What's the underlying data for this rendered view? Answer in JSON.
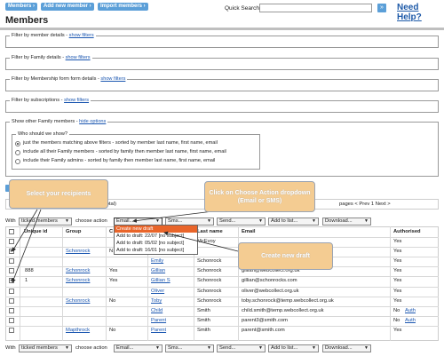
{
  "nav": {
    "members": "Members",
    "add_new_member": "Add new member",
    "import_members": "Import members"
  },
  "quick_search": {
    "label": "Quick Search",
    "value": ""
  },
  "help": "Need Help?",
  "page_title": "Members",
  "filters": {
    "member_details": {
      "label": "Filter by member details - ",
      "link": "show filters"
    },
    "family_details": {
      "label": "Filter by Family details - ",
      "link": "show filters"
    },
    "membership_form": {
      "label": "Filter by Membership form form details - ",
      "link": "show filters"
    },
    "subscriptions": {
      "label": "Filter by subscriptions - ",
      "link": "show filters"
    }
  },
  "other_family": {
    "label": "Show other Family members - ",
    "link": "hide options",
    "question": "Who should we show?",
    "options": [
      "just the members matching above filters - sorted by member last name, first name, email",
      "include all their Family members - sorted by family then member last name, first name, email",
      "include their Family admins - sorted by family then member last name, first name, email"
    ]
  },
  "pager": {
    "total_fragment": "total)",
    "nav": "pages < Prev 1 Next >"
  },
  "actions": {
    "with": "With",
    "ticked_members": "ticked members",
    "choose_action": "choose action",
    "email": "Email...",
    "sms": "Sms...",
    "send": "Send...",
    "add_to_list": "Add to list...",
    "download": "Download..."
  },
  "dropdown": [
    "Create new draft",
    "Add to draft: 22/07 [no subject]",
    "Add to draft: 05/02 [no subject]",
    "Add to draft: 16/01 [no subject]"
  ],
  "columns": [
    "Unique id",
    "Group",
    "C",
    "",
    "Last name",
    "Email",
    "Authorised"
  ],
  "rows": [
    {
      "checked": false,
      "uid": "",
      "group": "",
      "c": "",
      "first": "",
      "last": "McEvoy",
      "email": "",
      "auth": "Yes",
      "auth_link": ""
    },
    {
      "checked": true,
      "uid": "",
      "group": "Schonrock",
      "c": "N",
      "first": "",
      "last": "",
      "email": "",
      "auth": "Yes",
      "auth_link": ""
    },
    {
      "checked": false,
      "uid": "",
      "group": "",
      "c": "",
      "first": "Emily",
      "last": "Schonrock",
      "email": "@webcollect.org.uk",
      "auth": "Yes",
      "auth_link": ""
    },
    {
      "checked": false,
      "uid": "888",
      "group": "Schonrock",
      "c": "Yes",
      "first": "Gillian",
      "last": "Schonrock",
      "email": "gillian@webcollect.org.uk",
      "auth": "Yes",
      "auth_link": ""
    },
    {
      "checked": true,
      "uid": "1",
      "group": "Schonrock",
      "c": "Yes",
      "first": "Gillian S",
      "last": "Schonrock",
      "email": "gillian@schonrocks.com",
      "auth": "Yes",
      "auth_link": ""
    },
    {
      "checked": false,
      "uid": "",
      "group": "",
      "c": "",
      "first": "Oliver",
      "last": "Schonrock",
      "email": "oliver@webcollect.org.uk",
      "auth": "Yes",
      "auth_link": ""
    },
    {
      "checked": false,
      "uid": "",
      "group": "Schonrock",
      "c": "No",
      "first": "Toby",
      "last": "Schonrock",
      "email": "toby.schonrock@temp.webcollect.org.uk",
      "auth": "Yes",
      "auth_link": ""
    },
    {
      "checked": false,
      "uid": "",
      "group": "",
      "c": "",
      "first": "Child",
      "last": "Smith",
      "email": "child.smith@temp.webcollect.org.uk",
      "auth": "No",
      "auth_link": "Auth"
    },
    {
      "checked": false,
      "uid": "",
      "group": "",
      "c": "",
      "first": "Parent",
      "last": "Smith",
      "email": "parent3@smith.com",
      "auth": "No",
      "auth_link": "Auth"
    },
    {
      "checked": false,
      "uid": "",
      "group": "Mapthrock",
      "c": "No",
      "first": "Parent",
      "last": "Smith",
      "email": "parent@smith.com",
      "auth": "Yes",
      "auth_link": ""
    }
  ],
  "callouts": {
    "select_recipients": "Select your recipients",
    "choose_action": "Click on Choose Action dropdown (Email or SMS)",
    "create_draft": "Create new draft"
  },
  "colors": {
    "nav_blue": "#5b9fd8",
    "callout": "#f4cc92",
    "highlight": "#e9652a",
    "link": "#1a56b0"
  }
}
